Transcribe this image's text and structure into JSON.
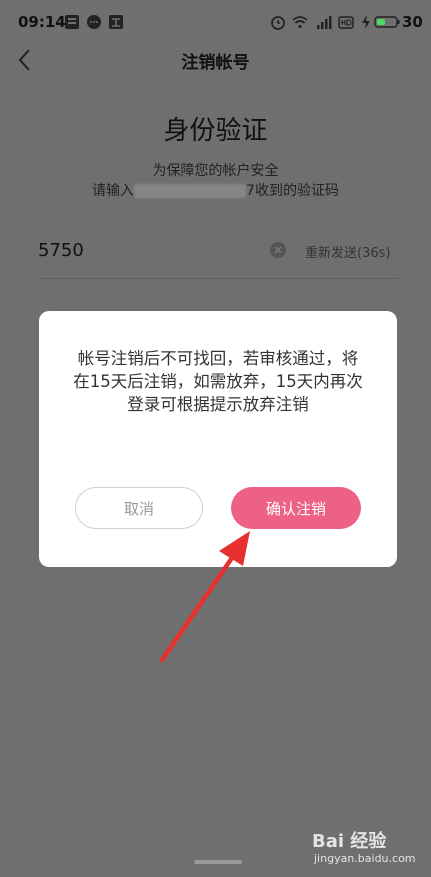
{
  "status_bar": {
    "time": "09:14",
    "battery_level": "30",
    "battery_color": "#4cd964"
  },
  "header": {
    "title": "注销帐号"
  },
  "verification": {
    "title": "身份验证",
    "line1": "为保障您的帐户安全",
    "line2_prefix": "请输入",
    "line2_suffix": "7收到的验证码",
    "code_value": "5750",
    "resend_label": "重新发送(36s)"
  },
  "dialog": {
    "message": "帐号注销后不可找回，若审核通过，将在15天后注销，如需放弃，15天内再次登录可根据提示放弃注销",
    "cancel_label": "取消",
    "confirm_label": "确认注销",
    "confirm_color": "#ee6186"
  },
  "annotation": {
    "arrow_color": "#e8302f"
  },
  "watermark": {
    "logo": "Bai 经验",
    "url": "jingyan.baidu.com"
  }
}
